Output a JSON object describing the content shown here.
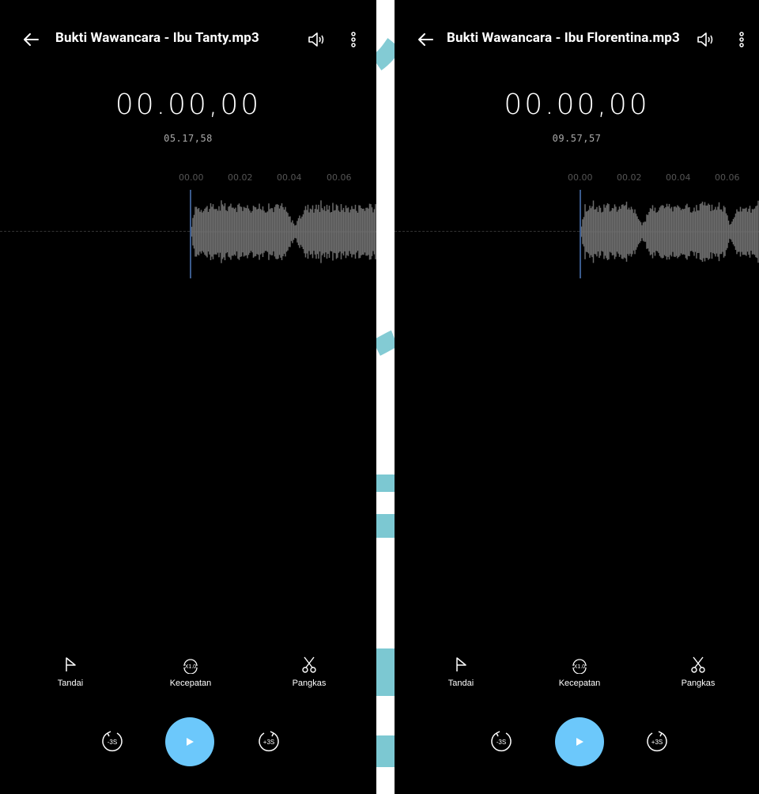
{
  "colors": {
    "background": "#000000",
    "accent": "#6cc8fb",
    "playhead": "#3a5a8c",
    "waveform": "#6b6b6b",
    "watermark": "#7cc8d2"
  },
  "screens": [
    {
      "title": "Bukti Wawancara - Ibu Tanty.mp3",
      "current_time": "00.00,00",
      "total_time": "05.17,58",
      "ticks": [
        "00.00",
        "00.02",
        "00.04",
        "00.06"
      ],
      "tools": [
        {
          "label": "Tandai",
          "icon": "flag-icon"
        },
        {
          "label": "Kecepatan",
          "icon": "speed-icon",
          "badge": "X1.0"
        },
        {
          "label": "Pangkas",
          "icon": "scissors-icon"
        }
      ],
      "rewind_label": "-3S",
      "forward_label": "+3S"
    },
    {
      "title": "Bukti Wawancara - Ibu Florentina.mp3",
      "current_time": "00.00,00",
      "total_time": "09.57,57",
      "ticks": [
        "00.00",
        "00.02",
        "00.04",
        "00.06"
      ],
      "tools": [
        {
          "label": "Tandai",
          "icon": "flag-icon"
        },
        {
          "label": "Kecepatan",
          "icon": "speed-icon",
          "badge": "X1.0"
        },
        {
          "label": "Pangkas",
          "icon": "scissors-icon"
        }
      ],
      "rewind_label": "-3S",
      "forward_label": "+3S"
    }
  ]
}
